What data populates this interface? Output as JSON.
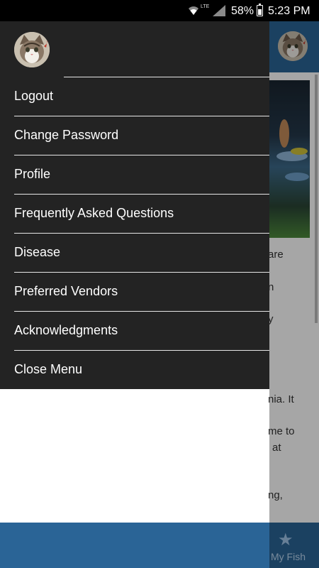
{
  "status_bar": {
    "lte_label": "LTE",
    "battery": "58%",
    "time": "5:23 PM",
    "icons": [
      "wifi-icon",
      "signal-icon",
      "battery-icon"
    ]
  },
  "drawer": {
    "menu_items": [
      {
        "label": "Logout"
      },
      {
        "label": "Change Password"
      },
      {
        "label": "Profile"
      },
      {
        "label": "Frequently Asked Questions"
      },
      {
        "label": "Disease"
      },
      {
        "label": "Preferred Vendors"
      },
      {
        "label": "Acknowledgments"
      },
      {
        "label": "Close Menu"
      }
    ]
  },
  "background_app": {
    "text_fragments": [
      "are",
      "n",
      "y",
      "nia. It",
      "me to",
      "at",
      "ng,"
    ],
    "bottom_nav": {
      "icon": "star-icon",
      "label": "My Fish"
    }
  },
  "colors": {
    "drawer_bg": "#232323",
    "app_bar": "#2a6496",
    "status_bar": "#000000",
    "divider": "#e6e6e6"
  }
}
